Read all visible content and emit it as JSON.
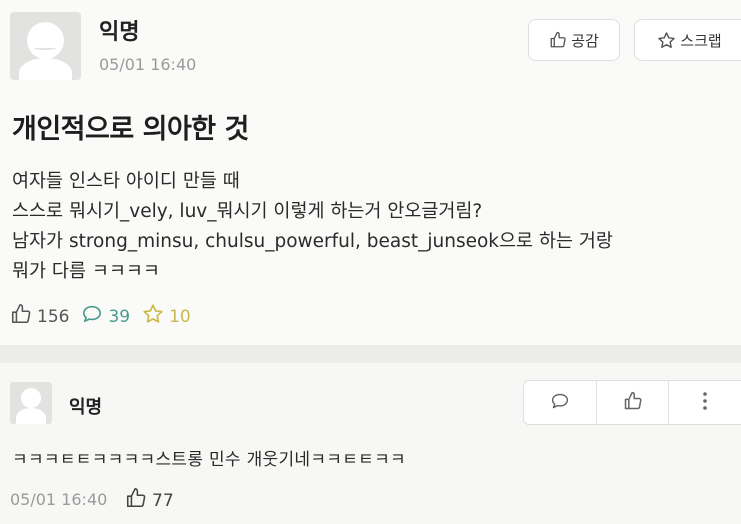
{
  "post": {
    "author": "익명",
    "timestamp": "05/01 16:40",
    "actions": {
      "like_label": "공감",
      "scrap_label": "스크랩"
    },
    "title": "개인적으로 의아한 것",
    "body_lines": [
      "여자들 인스타 아이디 만들 때",
      "스스로 뭐시기_vely, luv_뭐시기 이렇게 하는거 안오글거림?",
      "남자가 strong_minsu, chulsu_powerful, beast_junseok으로 하는 거랑",
      "뭐가 다름 ㅋㅋㅋㅋ"
    ],
    "stats": {
      "likes": "156",
      "comments": "39",
      "scraps": "10"
    }
  },
  "comment": {
    "author": "익명",
    "text": "ㅋㅋㅋㅌㅌㅋㅋㅋㅋ스트롱 민수 개웃기네ㅋㅋㅌㅌㅋㅋ",
    "timestamp": "05/01 16:40",
    "likes": "77"
  },
  "icons": {
    "thumbs_up": "thumbs-up-icon",
    "star": "star-icon",
    "speech_bubble": "speech-bubble-icon",
    "more": "more-vertical-icon"
  },
  "colors": {
    "comment_count": "#4a9b8e",
    "scrap_count": "#c9b94a",
    "timestamp": "#9a9a9a"
  }
}
